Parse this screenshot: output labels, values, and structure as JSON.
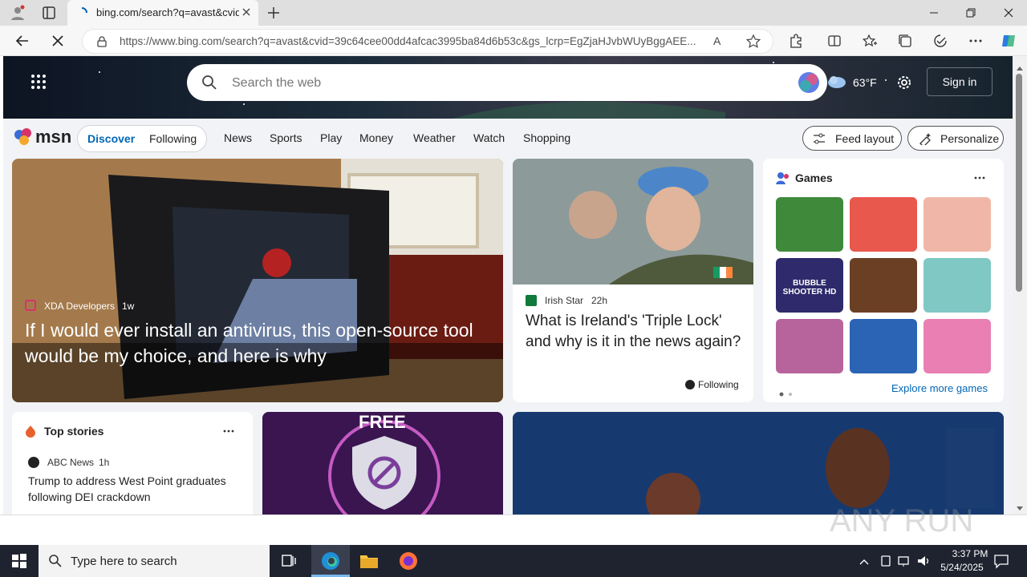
{
  "browser": {
    "tab_title": "bing.com/search?q=avast&cvid=",
    "url": "https://www.bing.com/search?q=avast&cvid=39c64cee00dd4afcac3995ba84d6b53c&gs_lcrp=EgZjaHJvbWUyBggAEE..."
  },
  "header": {
    "search_placeholder": "Search the web",
    "temperature": "63°F",
    "sign_in": "Sign in"
  },
  "msn": {
    "logo": "msn",
    "pill_tabs": [
      "Discover",
      "Following"
    ],
    "nav": [
      "News",
      "Sports",
      "Play",
      "Money",
      "Weather",
      "Watch",
      "Shopping"
    ],
    "feed_layout": "Feed layout",
    "personalize": "Personalize"
  },
  "main_story": {
    "source": "XDA Developers",
    "age": "1w",
    "headline": "If I would ever install an antivirus, this open-source tool would be my choice, and here is why"
  },
  "second_story": {
    "source": "Irish Star",
    "age": "22h",
    "headline": "What is Ireland's 'Triple Lock' and why is it in the news again?",
    "badge": "Following"
  },
  "games": {
    "title": "Games",
    "explore": "Explore more games",
    "tiles": [
      "#3f8a3a",
      "#e9584d",
      "#f0b7a8",
      "#2f2a6b",
      "#6a3f24",
      "#7fc8c4",
      "#b8649c",
      "#2b63b5",
      "#e97fb2"
    ],
    "bubble_label": "BUBBLE SHOOTER HD"
  },
  "top_stories": {
    "title": "Top stories",
    "source": "ABC News",
    "age": "1h",
    "headline": "Trump to address West Point graduates following DEI crackdown"
  },
  "promo": {
    "label": "FREE"
  },
  "taskbar": {
    "search_placeholder": "Type here to search",
    "time": "3:37 PM",
    "date": "5/24/2025"
  },
  "colors": {
    "accent": "#0067b8",
    "taskbar": "#1f2330"
  }
}
